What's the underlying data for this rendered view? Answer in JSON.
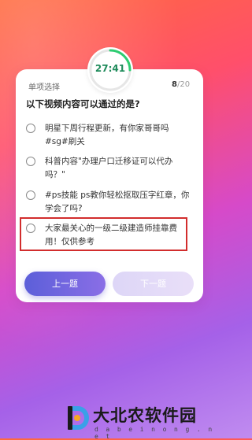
{
  "timer": {
    "text": "27:41",
    "ring_color": "#2ecc71"
  },
  "quiz": {
    "type_label": "单项选择",
    "current": "8",
    "total": "/20",
    "question": "以下视频内容可以通过的是?",
    "options": [
      {
        "text": "明星下周行程更新，有你家哥哥吗#sg#刷关",
        "selected": false
      },
      {
        "text": "科普内容\"办理户口迁移证可以代办吗？\"",
        "selected": false
      },
      {
        "text": "#ps技能 ps教你轻松抠取压字红章，你学会了吗?",
        "selected": false
      },
      {
        "text": "大家最关心的一级二级建造师挂靠费用！仅供参考",
        "selected": false
      }
    ]
  },
  "buttons": {
    "prev_label": "上一题",
    "next_label": "下一题"
  },
  "watermark": {
    "name": "大北农软件园",
    "url": "d a b e i n o n g . n e t",
    "accent_color": "#3aa0e8"
  }
}
